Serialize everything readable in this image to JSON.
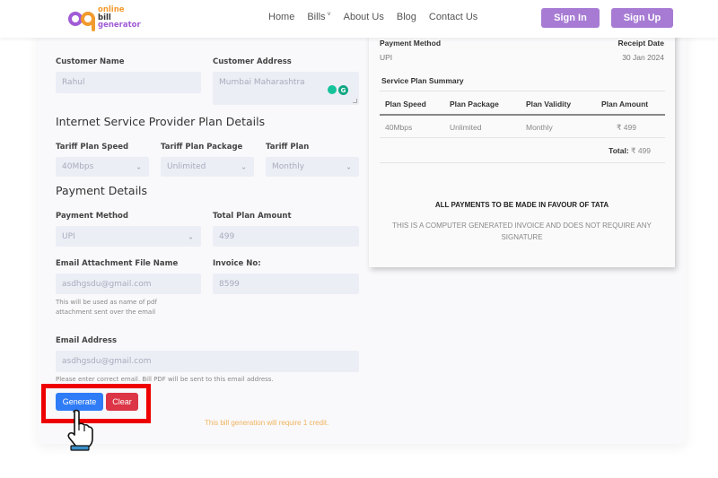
{
  "header": {
    "logo": {
      "line1": "online",
      "line2": "bill",
      "line3": "generator"
    },
    "nav": [
      {
        "label": "Home"
      },
      {
        "label": "Bills",
        "has_dropdown": true
      },
      {
        "label": "About Us"
      },
      {
        "label": "Blog"
      },
      {
        "label": "Contact Us"
      }
    ],
    "sign_in": "Sign In",
    "sign_up": "Sign Up",
    "accent_color": "#a77bd4"
  },
  "form": {
    "customer_name_label": "Customer Name",
    "customer_name_value": "Rahul",
    "customer_address_label": "Customer Address",
    "customer_address_value": "Mumbai Maharashtra",
    "isp_section_title": "Internet Service Provider Plan Details",
    "tariff_speed_label": "Tariff Plan Speed",
    "tariff_speed_value": "40Mbps",
    "tariff_package_label": "Tariff Plan Package",
    "tariff_package_value": "Unlimited",
    "tariff_plan_label": "Tariff Plan",
    "tariff_plan_value": "Monthly",
    "payment_section_title": "Payment Details",
    "payment_method_label": "Payment Method",
    "payment_method_value": "UPI",
    "total_amount_label": "Total Plan Amount",
    "total_amount_value": "499",
    "attachment_label": "Email Attachment File Name",
    "attachment_value": "asdhgsdu@gmail.com",
    "attachment_hint_1": "This will be used as name of pdf",
    "attachment_hint_2": "attachment sent over the email",
    "invoice_label": "Invoice No:",
    "invoice_value": "8599",
    "email_label": "Email Address",
    "email_value": "asdhgsdu@gmail.com",
    "email_hint": "Please enter correct email. Bill PDF will be sent to this email address.",
    "generate_button": "Generate",
    "clear_button": "Clear",
    "credit_note": "This bill generation will require 1 credit."
  },
  "receipt": {
    "payment_method_label": "Payment Method",
    "payment_method_value": "UPI",
    "receipt_date_label": "Receipt Date",
    "receipt_date_value": "30 Jan 2024",
    "summary_title": "Service Plan Summary",
    "table": {
      "headers": [
        "Plan Speed",
        "Plan Package",
        "Plan Validity",
        "Plan Amount"
      ],
      "rows": [
        [
          "40Mbps",
          "Unlimited",
          "Monthly",
          "₹ 499"
        ]
      ]
    },
    "total_label": "Total:",
    "total_value": "₹ 499",
    "favour_note": "ALL PAYMENTS TO BE MADE IN FAVOUR OF TATA",
    "computer_note": "THIS IS A COMPUTER GENERATED INVOICE AND DOES NOT REQUIRE ANY SIGNATURE"
  }
}
